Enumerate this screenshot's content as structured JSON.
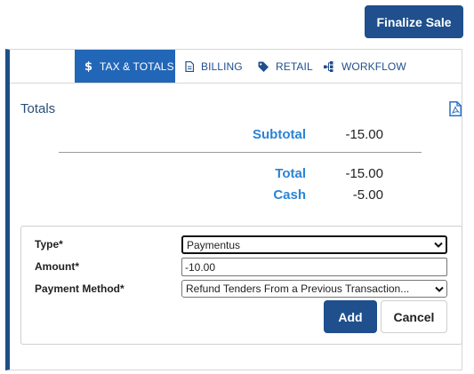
{
  "header": {
    "finalize_label": "Finalize Sale"
  },
  "tabs": [
    {
      "label": "TAX & TOTALS",
      "icon": "dollar-icon",
      "active": true
    },
    {
      "label": "BILLING",
      "icon": "document-icon",
      "active": false
    },
    {
      "label": "RETAIL",
      "icon": "tag-icon",
      "active": false
    },
    {
      "label": "WORKFLOW",
      "icon": "workflow-icon",
      "active": false
    }
  ],
  "totals": {
    "title": "Totals",
    "subtotal": {
      "label": "Subtotal",
      "value": "-15.00"
    },
    "total": {
      "label": "Total",
      "value": "-15.00"
    },
    "cash": {
      "label": "Cash",
      "value": "-5.00"
    }
  },
  "payment_form": {
    "type_label": "Type*",
    "type_value": "Paymentus",
    "amount_label": "Amount*",
    "amount_value": "-10.00",
    "method_label": "Payment Method*",
    "method_value": "Refund Tenders From a Previous Transaction...",
    "add_label": "Add",
    "cancel_label": "Cancel"
  },
  "colors": {
    "primary": "#1f4f8c",
    "tab_active": "#2266b8",
    "label_blue": "#2a84d6",
    "panel_accent": "#1d4f86"
  }
}
